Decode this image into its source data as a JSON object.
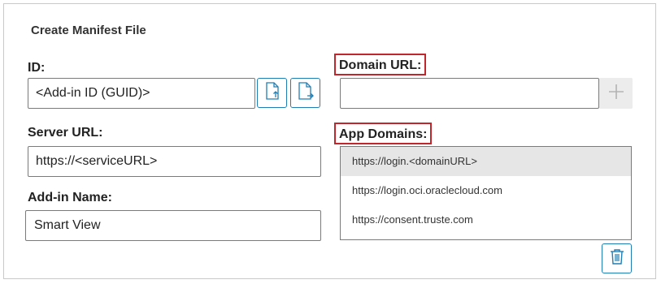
{
  "panel": {
    "title": "Create Manifest File"
  },
  "id_field": {
    "label": "ID:",
    "value": "<Add-in ID (GUID)>",
    "buttons": [
      {
        "icon": "file-import-icon"
      },
      {
        "icon": "file-export-icon"
      }
    ]
  },
  "server_url": {
    "label": "Server URL:",
    "value": "https://<serviceURL>"
  },
  "addin_name": {
    "label": "Add-in Name:",
    "value": "Smart View"
  },
  "domain_url": {
    "label": "Domain URL:",
    "value": "",
    "add_icon": "plus-icon"
  },
  "app_domains": {
    "label": "App Domains:",
    "items": [
      "https://login.<domainURL>",
      "https://login.oci.oraclecloud.com",
      "https://consent.truste.com"
    ],
    "selected_index": 0,
    "delete_icon": "trash-icon"
  },
  "colors": {
    "highlight_border": "#c0272d",
    "accent": "#1f7fb5",
    "selected_row": "#e6e6e6"
  }
}
